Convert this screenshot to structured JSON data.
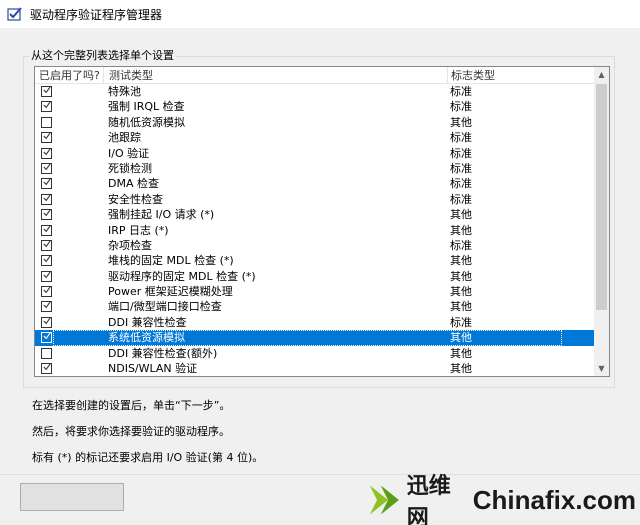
{
  "window": {
    "title": "驱动程序验证程序管理器"
  },
  "group": {
    "label": "从这个完整列表选择单个设置"
  },
  "list": {
    "columns": [
      "已启用了吗?",
      "测试类型",
      "标志类型"
    ],
    "rows": [
      {
        "checked": true,
        "name": "特殊池",
        "type": "标准",
        "selected": false
      },
      {
        "checked": true,
        "name": "强制 IRQL 检查",
        "type": "标准",
        "selected": false
      },
      {
        "checked": false,
        "name": "随机低资源模拟",
        "type": "其他",
        "selected": false
      },
      {
        "checked": true,
        "name": "池跟踪",
        "type": "标准",
        "selected": false
      },
      {
        "checked": true,
        "name": "I/O 验证",
        "type": "标准",
        "selected": false
      },
      {
        "checked": true,
        "name": "死锁检测",
        "type": "标准",
        "selected": false
      },
      {
        "checked": true,
        "name": "DMA 检查",
        "type": "标准",
        "selected": false
      },
      {
        "checked": true,
        "name": "安全性检查",
        "type": "标准",
        "selected": false
      },
      {
        "checked": true,
        "name": "强制挂起 I/O 请求 (*)",
        "type": "其他",
        "selected": false
      },
      {
        "checked": true,
        "name": "IRP 日志 (*)",
        "type": "其他",
        "selected": false
      },
      {
        "checked": true,
        "name": "杂项检查",
        "type": "标准",
        "selected": false
      },
      {
        "checked": true,
        "name": "堆栈的固定 MDL 检查 (*)",
        "type": "其他",
        "selected": false
      },
      {
        "checked": true,
        "name": "驱动程序的固定 MDL 检查 (*)",
        "type": "其他",
        "selected": false
      },
      {
        "checked": true,
        "name": "Power 框架延迟模糊处理",
        "type": "其他",
        "selected": false
      },
      {
        "checked": true,
        "name": "端口/微型端口接口检查",
        "type": "其他",
        "selected": false
      },
      {
        "checked": true,
        "name": "DDI 兼容性检查",
        "type": "标准",
        "selected": false
      },
      {
        "checked": true,
        "name": "系统低资源模拟",
        "type": "其他",
        "selected": true
      },
      {
        "checked": false,
        "name": "DDI 兼容性检查(额外)",
        "type": "其他",
        "selected": false
      },
      {
        "checked": true,
        "name": "NDIS/WLAN 验证",
        "type": "其他",
        "selected": false
      }
    ]
  },
  "instructions": [
    "在选择要创建的设置后，单击“下一步”。",
    "然后，将要求你选择要验证的驱动程序。",
    "标有 (*) 的标记还要求启用 I/O 验证(第 4 位)。"
  ],
  "watermark": {
    "cn": "迅维网",
    "en": "Chinafix.com"
  },
  "colors": {
    "selection": "#0078d7",
    "background": "#f0f0f0"
  }
}
